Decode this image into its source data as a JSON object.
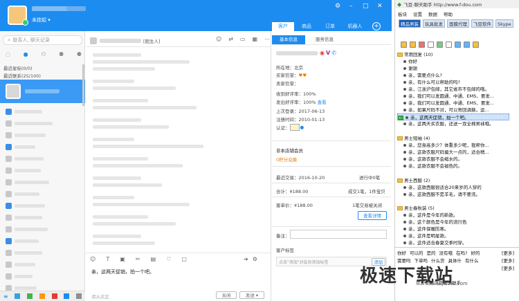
{
  "header": {
    "status_label": "未挂起 ▾",
    "tabs": [
      {
        "label": "客户",
        "active": true
      },
      {
        "label": "商品",
        "active": false
      },
      {
        "label": "订单",
        "active": false
      },
      {
        "label": "机器人",
        "active": false
      }
    ],
    "add_label": "+"
  },
  "left": {
    "search_placeholder": "联系人, 聊天记录",
    "recent_flag": "最近星标(0/0)",
    "recent_contacts": "最近联系(25/100)"
  },
  "chat": {
    "contact_suffix": "[陌生人]",
    "input_text": "亲，这两天促销，拍一个吧。",
    "input_placeholder": "请从此区",
    "close_label": "关闭",
    "send_label": "发送 ▾"
  },
  "info": {
    "tab_basic": "基本信息",
    "tab_service": "服务信息",
    "location": "所在地：北京",
    "buyer_credit": "买家信誉：",
    "seller_credit": "卖家信誉：",
    "received_rate": "收到好评率：100%",
    "sent_rate": "发出好评率：100%",
    "view_link": "查看",
    "last_login": "上次登录：2017-06-13",
    "register_time": "注册时间：2010-01-13",
    "verify": "认证：",
    "non_member": "非本店铺会员",
    "points": "0积分兑换",
    "recent_trade_label": "最近交易：",
    "recent_trade_date": "2016-10-20",
    "in_progress": "进行中0笔",
    "total": "合计：¥188.00",
    "deal": "成交1笔，1件宝贝",
    "customer_price": "客单价：¥188.00",
    "refund": "1笔交易被关闭",
    "detail_btn": "查看详情",
    "note_label": "备注：",
    "tag_label": "客户标签",
    "tag_placeholder": "点击\"添加\"对会员添加标签",
    "add_btn": "添加"
  },
  "rapp": {
    "title": "飞豆-聊天助手 http://www.f-dou.com",
    "menu": [
      "板块",
      "设置",
      "数据",
      "帮助"
    ],
    "tabs": [
      {
        "label": "精品男装",
        "active": true
      },
      {
        "label": "玩具批发",
        "active": false
      },
      {
        "label": "面膜代理",
        "active": false
      },
      {
        "label": "飞豆软件",
        "active": false
      },
      {
        "label": "Skype",
        "active": false
      }
    ],
    "groups": [
      {
        "name": "常用回复 (10)",
        "items": [
          "你好",
          "谢谢",
          "亲，需要点什么?",
          "亲，有什么可以帮助的吗?",
          "亲，江浙沪包邮，其它省市不包邮的哦。",
          "亲，我们可以发圆通、中通、EMS、要发...",
          "亲，我们可以发圆通、中通、EMS、要发...",
          "亲，如果尺码不对，可以寄回调换，运...",
          "亲，这两天促销，拍一个吧。",
          "亲，这两天买衣服，还送一双全棉男袜哦。"
        ]
      },
      {
        "name": "男士短袖 (4)",
        "items": [
          "亲，您身高多少？体重多少呢，我帮你...",
          "亲，这款衣服尺码偏大一点的，适合稍...",
          "亲，这款衣服不会缩水的。",
          "亲，这款衣服不会褪色的。"
        ]
      },
      {
        "name": "男士西服 (2)",
        "items": [
          "亲，这款西服很适合20来岁的人穿的",
          "亲，这款西服不是羊毛，请不要洗。"
        ]
      },
      {
        "name": "男士春秋装 (5)",
        "items": [
          "亲，这件是今年的新款。",
          "亲，这个颜色是今年的流行色",
          "亲，这件保暖防寒。",
          "亲，这件是明星款。",
          "亲，这件适合春夏交季时穿。"
        ]
      }
    ],
    "quick_row1": [
      "你好",
      "可以的",
      "是的",
      "没有哦",
      "在吗?",
      "好的"
    ],
    "quick_row2": [
      "需要吗",
      "下单吗",
      "什么货",
      "具体什",
      "有什么"
    ],
    "more1": "[更多]",
    "more2": "[更多]",
    "more3": "[更多]",
    "bottom_text": "欢迎使用飞豆聊天助手"
  },
  "watermark": {
    "text": "极速下载站",
    "url": "www.jisuxz.com"
  }
}
